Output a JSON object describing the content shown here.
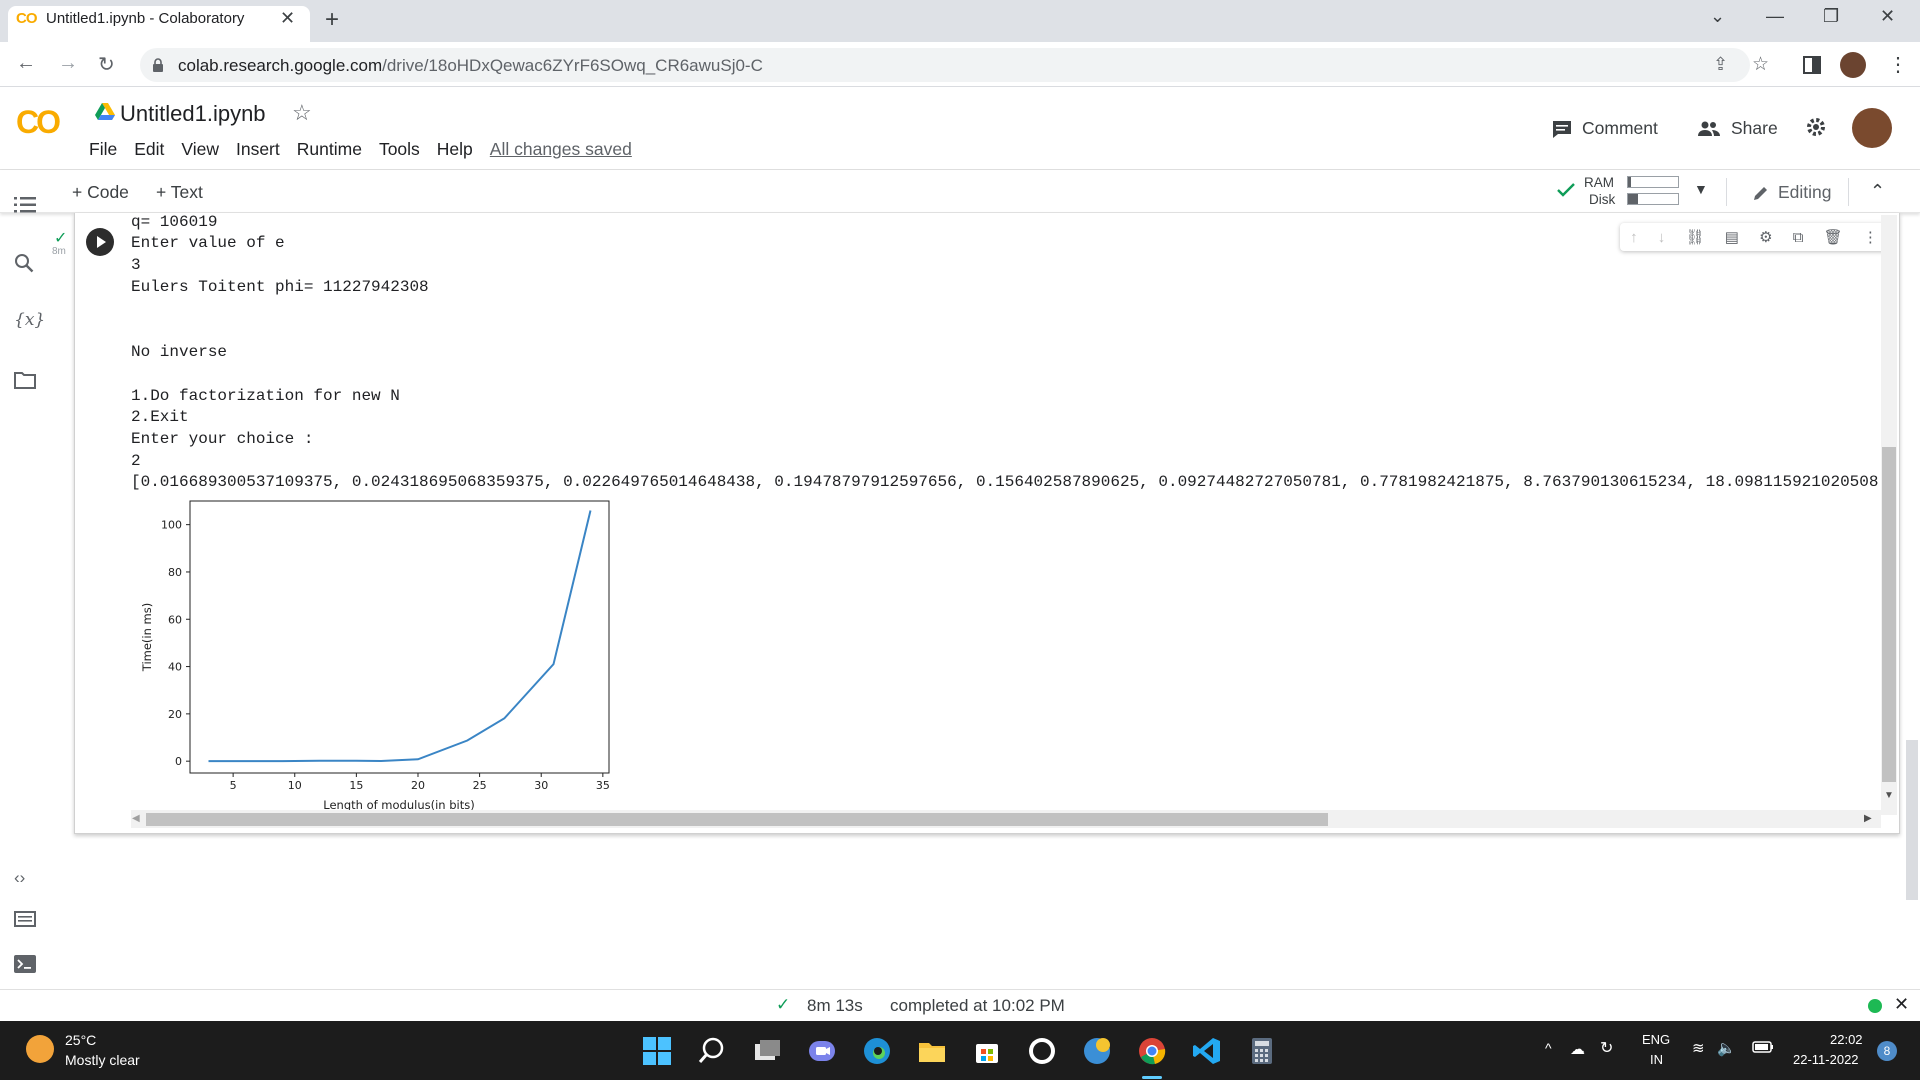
{
  "browser": {
    "tab_title": "Untitled1.ipynb - Colaboratory",
    "tab_logo": "CO",
    "url_host": "colab.research.google.com",
    "url_path": "/drive/18oHDxQewac6ZYrF6SOwq_CR6awuSj0-C"
  },
  "colab": {
    "logo": "CO",
    "notebook_title": "Untitled1.ipynb",
    "menu": [
      "File",
      "Edit",
      "View",
      "Insert",
      "Runtime",
      "Tools",
      "Help"
    ],
    "saved_status": "All changes saved",
    "comment_label": "Comment",
    "share_label": "Share",
    "add_code_label": "+ Code",
    "add_text_label": "+ Text",
    "ram_label": "RAM",
    "disk_label": "Disk",
    "ram_usage": 0.05,
    "disk_usage": 0.2,
    "editing_label": "Editing"
  },
  "cell": {
    "exec_time": "8m",
    "output_lines": [
      "q= 106019",
      "Enter value of e",
      "3",
      "Eulers Toitent phi= 11227942308",
      "",
      "",
      "No inverse",
      "",
      "1.Do factorization for new N",
      "2.Exit",
      "Enter your choice :",
      "2",
      "[0.016689300537109375, 0.024318695068359375, 0.022649765014648438, 0.19478797912597656, 0.156402587890625, 0.09274482727050781, 0.7781982421875, 8.763790130615234, 18.098115921020508"
    ]
  },
  "chart_data": {
    "type": "line",
    "title": "",
    "xlabel": "Length of modulus(in bits)",
    "ylabel": "Time(in ms)",
    "xlim": [
      1.5,
      35.5
    ],
    "ylim": [
      -5,
      110
    ],
    "xticks": [
      5,
      10,
      15,
      20,
      25,
      30,
      35
    ],
    "yticks": [
      0,
      20,
      40,
      60,
      80,
      100
    ],
    "color": "#3a85c5",
    "series": [
      {
        "x": [
          3,
          6,
          9,
          12,
          15,
          17,
          20,
          24,
          27,
          31,
          34
        ],
        "y": [
          0.017,
          0.024,
          0.023,
          0.195,
          0.156,
          0.093,
          0.778,
          8.76,
          18.1,
          41,
          106
        ]
      }
    ]
  },
  "status": {
    "elapsed": "8m 13s",
    "completed": "completed at 10:02 PM"
  },
  "taskbar": {
    "temperature": "25°C",
    "weather": "Mostly clear",
    "lang_line1": "ENG",
    "lang_line2": "IN",
    "time": "22:02",
    "date": "22-11-2022",
    "notifications": "8"
  }
}
